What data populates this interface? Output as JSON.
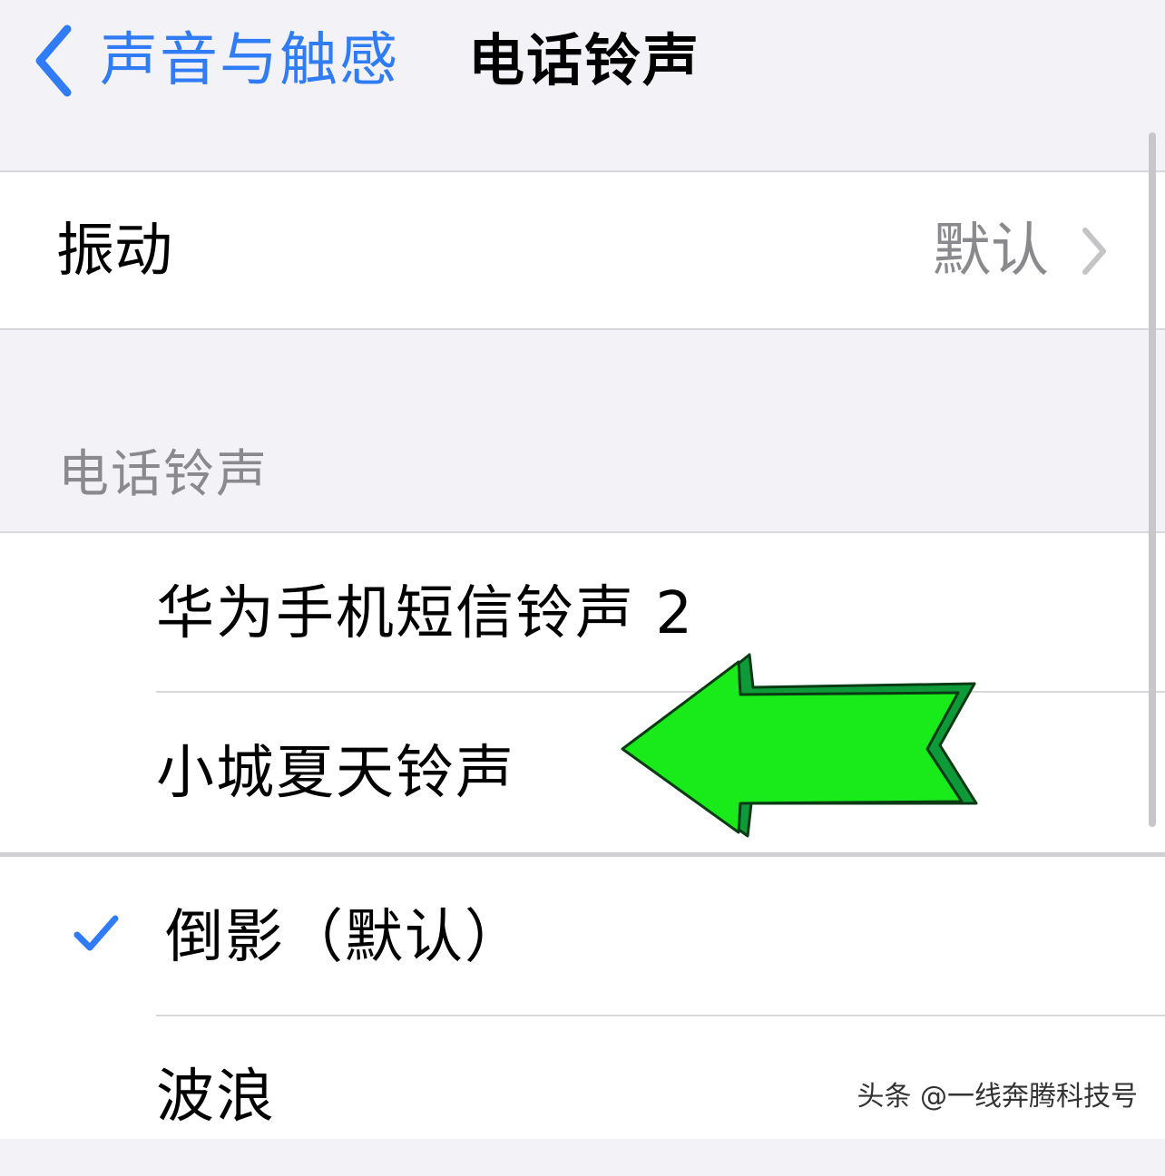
{
  "navbar": {
    "back_label": "声音与触感",
    "title": "电话铃声",
    "accent_color": "#2f7cf6"
  },
  "vibration": {
    "label": "振动",
    "value": "默认"
  },
  "section_header": "电话铃声",
  "ringtones": [
    {
      "label": "华为手机短信铃声 2",
      "selected": false
    },
    {
      "label": "小城夏天铃声",
      "selected": false
    },
    {
      "label": "倒影（默认）",
      "selected": true
    },
    {
      "label": "波浪",
      "selected": false
    }
  ],
  "annotation": {
    "arrow_color": "#19ea1a",
    "arrow_shadow_color": "#0f9a3a",
    "points_to": "小城夏天铃声"
  },
  "watermark": "头条 @一线奔腾科技号",
  "icons": {
    "back": "chevron-left-icon",
    "disclosure": "chevron-right-icon",
    "selected": "checkmark-icon"
  }
}
